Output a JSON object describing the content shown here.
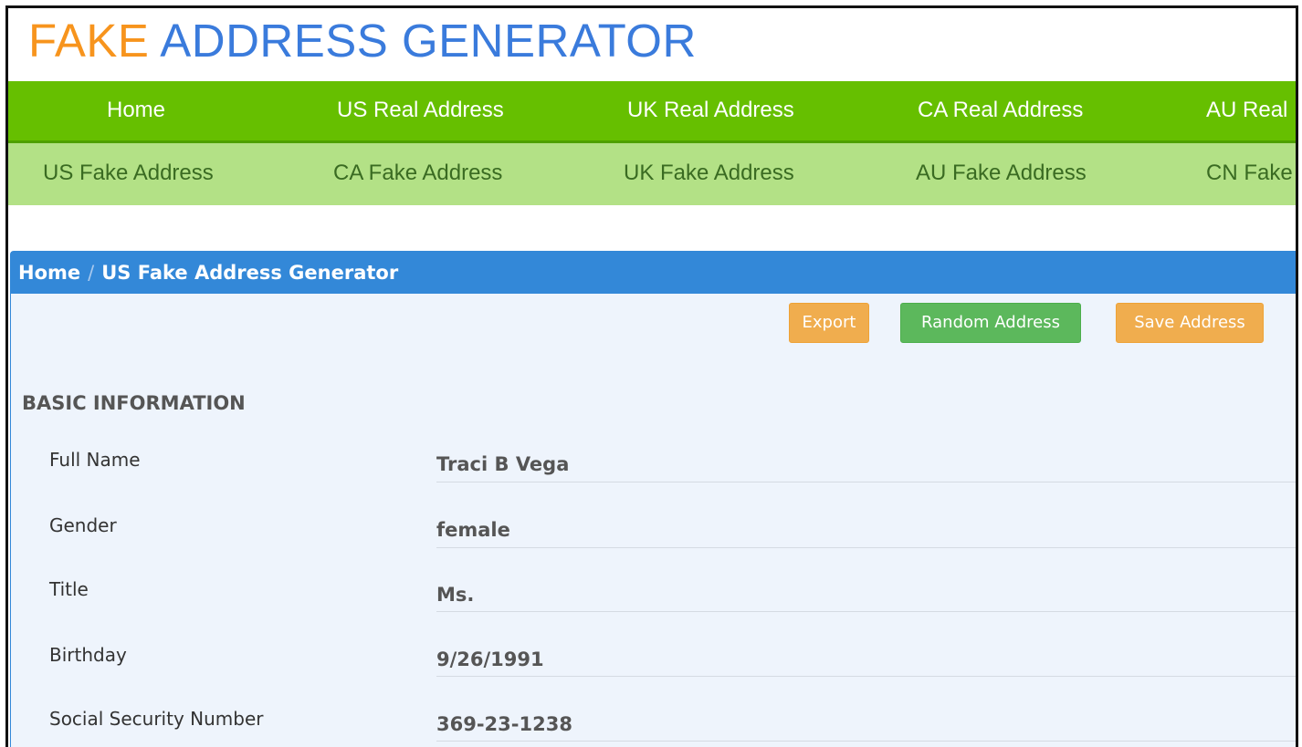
{
  "logo": {
    "part1": "FAKE",
    "part2": "ADDRESS GENERATOR",
    "colors": {
      "part1": "#f7941d",
      "part2": "#3a7bdc"
    }
  },
  "nav_primary": {
    "color": "#66bf00",
    "items": [
      {
        "label": "Home"
      },
      {
        "label": "US Real Address"
      },
      {
        "label": "UK Real Address"
      },
      {
        "label": "CA Real Address"
      },
      {
        "label": "AU Real"
      }
    ]
  },
  "nav_secondary": {
    "color": "#b3e186",
    "items": [
      {
        "label": "US Fake Address"
      },
      {
        "label": "CA Fake Address"
      },
      {
        "label": "UK Fake Address"
      },
      {
        "label": "AU Fake Address"
      },
      {
        "label": "CN Fake"
      }
    ]
  },
  "breadcrumb": {
    "home": "Home",
    "separator": "/",
    "current": "US Fake Address Generator"
  },
  "actions": {
    "export_label": "Export",
    "random_label": "Random Address",
    "save_label": "Save Address"
  },
  "basic_info": {
    "title": "BASIC INFORMATION",
    "rows": [
      {
        "label": "Full Name",
        "value": "Traci B Vega"
      },
      {
        "label": "Gender",
        "value": "female"
      },
      {
        "label": "Title",
        "value": "Ms."
      },
      {
        "label": "Birthday",
        "value": "9/26/1991"
      },
      {
        "label": "Social Security Number",
        "value": "369-23-1238"
      }
    ]
  }
}
